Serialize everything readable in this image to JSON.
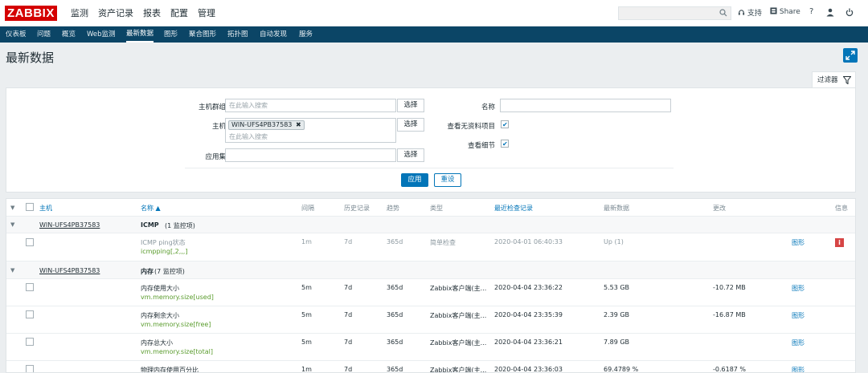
{
  "header": {
    "logo": "ZABBIX",
    "nav": [
      "监测",
      "资产记录",
      "报表",
      "配置",
      "管理"
    ],
    "support": "支持",
    "share": "Share",
    "help": "?"
  },
  "subnav": [
    "仪表板",
    "问题",
    "概览",
    "Web监测",
    "最新数据",
    "图形",
    "聚合图形",
    "拓扑图",
    "自动发现",
    "服务"
  ],
  "page": {
    "title": "最新数据",
    "filter_tab": "过滤器"
  },
  "filter": {
    "host_group_label": "主机群组",
    "host_group_placeholder": "在此输入搜索",
    "host_label": "主机",
    "host_tag": "WIN-UFS4PB37583",
    "host_placeholder": "在此输入搜索",
    "app_label": "应用集",
    "select_label": "选择",
    "name_label": "名称",
    "show_no_data_label": "查看无资料项目",
    "show_details_label": "查看细节",
    "apply": "应用",
    "reset": "重设"
  },
  "table": {
    "headers": {
      "host": "主机",
      "name": "名称 ▲",
      "interval": "间隔",
      "history": "历史记录",
      "trends": "趋势",
      "type": "类型",
      "last_check": "最近检查记录",
      "last_value": "最新数据",
      "change": "更改",
      "info": "信息"
    },
    "groups": [
      {
        "host": "WIN-UFS4PB37583",
        "app": "ICMP",
        "count": "(1 监控项)"
      },
      {
        "host": "WIN-UFS4PB37583",
        "app": "内存",
        "count": "(7 监控项)"
      }
    ],
    "items": [
      {
        "name": "ICMP ping状态",
        "key": "icmpping[,2,,,]",
        "interval": "1m",
        "history": "7d",
        "trends": "365d",
        "type": "简单检查",
        "last_check": "2020-04-01 06:40:33",
        "last_value": "Up (1)",
        "change": "",
        "graph": "图形",
        "info": "i"
      },
      {
        "name": "内存使用大小",
        "key": "vm.memory.size[used]",
        "interval": "5m",
        "history": "7d",
        "trends": "365d",
        "type": "Zabbix客户端(主...",
        "last_check": "2020-04-04 23:36:22",
        "last_value": "5.53 GB",
        "change": "-10.72 MB",
        "graph": "图形"
      },
      {
        "name": "内存剩余大小",
        "key": "vm.memory.size[free]",
        "interval": "5m",
        "history": "7d",
        "trends": "365d",
        "type": "Zabbix客户端(主...",
        "last_check": "2020-04-04 23:35:39",
        "last_value": "2.39 GB",
        "change": "-16.87 MB",
        "graph": "图形"
      },
      {
        "name": "内存总大小",
        "key": "vm.memory.size[total]",
        "interval": "5m",
        "history": "7d",
        "trends": "365d",
        "type": "Zabbix客户端(主...",
        "last_check": "2020-04-04 23:36:21",
        "last_value": "7.89 GB",
        "change": "",
        "graph": "图形"
      },
      {
        "name": "物理内存使用百分比",
        "key": "",
        "interval": "1m",
        "history": "7d",
        "trends": "365d",
        "type": "Zabbix客户端(主...",
        "last_check": "2020-04-04 23:36:03",
        "last_value": "69.4789 %",
        "change": "-0.6187 %",
        "graph": "图形"
      }
    ]
  }
}
